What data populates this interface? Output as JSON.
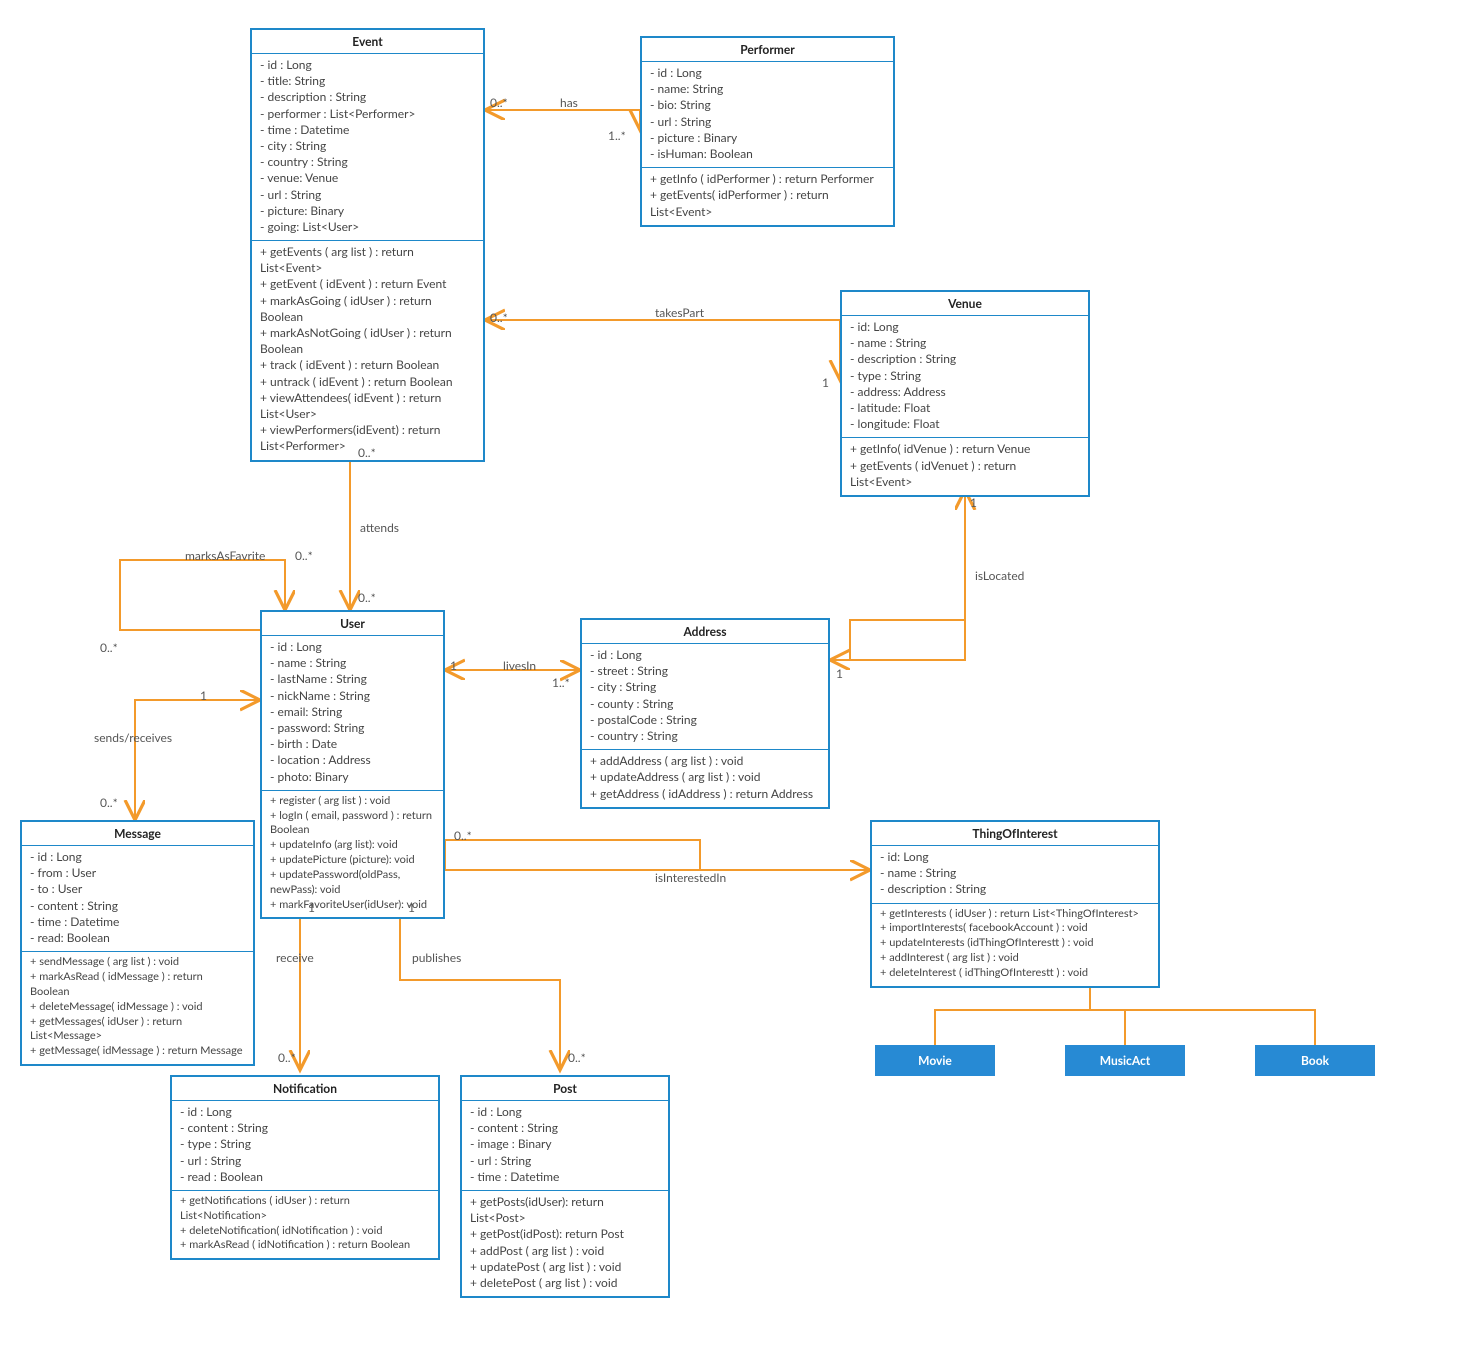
{
  "chart_data": {
    "type": "uml_class_diagram",
    "classes": [
      {
        "id": "Event",
        "title": "Event",
        "attributes": [
          "- id : Long",
          "- title: String",
          "- description : String",
          "- performer : List<Performer>",
          "- time : Datetime",
          "- city : String",
          "- country : String",
          "- venue: Venue",
          "- url : String",
          "- picture: Binary",
          "- going: List<User>"
        ],
        "methods": [
          "+ getEvents ( arg list ) : return List<Event>",
          "+ getEvent ( idEvent ) : return Event",
          "+ markAsGoing ( idUser ) : return Boolean",
          "+ markAsNotGoing ( idUser ) : return Boolean",
          "+ track ( idEvent ) : return Boolean",
          "+ untrack ( idEvent ) : return Boolean",
          "+ viewAttendees( idEvent ) : return List<User>",
          "+ viewPerformers(idEvent) : return List<Performer>"
        ]
      },
      {
        "id": "Performer",
        "title": "Performer",
        "attributes": [
          "- id : Long",
          "- name: String",
          "- bio: String",
          "- url : String",
          "- picture : Binary",
          "- isHuman: Boolean"
        ],
        "methods": [
          "+ getInfo ( idPerformer ) : return Performer",
          "+ getEvents( idPerformer ) : return List<Event>"
        ]
      },
      {
        "id": "Venue",
        "title": "Venue",
        "attributes": [
          "- id: Long",
          "- name : String",
          "- description : String",
          "- type : String",
          "- address: Address",
          "- latitude: Float",
          "- longitude: Float"
        ],
        "methods": [
          "+ getInfo( idVenue ) : return Venue",
          "+ getEvents ( idVenuet ) : return List<Event>"
        ]
      },
      {
        "id": "User",
        "title": "User",
        "attributes": [
          "- id : Long",
          "- name : String",
          "- lastName : String",
          "- nickName : String",
          "- email: String",
          "- password: String",
          "- birth : Date",
          "- location : Address",
          "- photo: Binary"
        ],
        "methods": [
          "+ register ( arg list ) : void",
          "+ logIn ( email, password ) : return Boolean",
          "+ updateInfo (arg list): void",
          "+ updatePicture (picture): void",
          "+ updatePassword(oldPass, newPass): void",
          "+ markFavoriteUser(idUser): void"
        ]
      },
      {
        "id": "Address",
        "title": "Address",
        "attributes": [
          "- id : Long",
          "- street : String",
          "- city : String",
          "- county : String",
          "- postalCode : String",
          "- country : String"
        ],
        "methods": [
          "+ addAddress ( arg list ) : void",
          "+ updateAddress ( arg list ) : void",
          "+ getAddress ( idAddress ) : return Address"
        ]
      },
      {
        "id": "Message",
        "title": "Message",
        "attributes": [
          "- id : Long",
          "- from : User",
          "- to : User",
          "- content : String",
          "- time : Datetime",
          "- read: Boolean"
        ],
        "methods": [
          "+ sendMessage ( arg list ) : void",
          "+ markAsRead ( idMessage ) : return Boolean",
          "+ deleteMessage( idMessage ) : void",
          "+ getMessages( idUser ) : return List<Message>",
          "+ getMessage( idMessage ) : return Message"
        ]
      },
      {
        "id": "ThingOfInterest",
        "title": "ThingOfInterest",
        "attributes": [
          "- id: Long",
          "- name : String",
          "- description : String"
        ],
        "methods": [
          "+ getInterests ( idUser ) : return List<ThingOfInterest>",
          "+ importInterests( facebookAccount ) : void",
          "+ updateInterests (idThingOfInterestt ) : void",
          "+ addInterest ( arg list ) : void",
          "+ deleteInterest ( idThingOfInterestt ) : void"
        ]
      },
      {
        "id": "Notification",
        "title": "Notification",
        "attributes": [
          "- id : Long",
          "- content : String",
          "- type : String",
          "- url : String",
          "- read : Boolean"
        ],
        "methods": [
          "+ getNotifications ( idUser ) : return List<Notification>",
          "+ deleteNotification( idNotification ) : void",
          "+ markAsRead ( idNotification ) : return Boolean"
        ]
      },
      {
        "id": "Post",
        "title": "Post",
        "attributes": [
          "- id : Long",
          "- content : String",
          "- image : Binary",
          "- url : String",
          "- time : Datetime"
        ],
        "methods": [
          "+ getPosts(idUser): return List<Post>",
          "+ getPost(idPost): return Post",
          "+ addPost ( arg list ) : void",
          "+ updatePost ( arg list ) : void",
          "+ deletePost ( arg list ) : void"
        ]
      },
      {
        "id": "Movie",
        "title": "Movie",
        "solid": true
      },
      {
        "id": "MusicAct",
        "title": "MusicAct",
        "solid": true
      },
      {
        "id": "Book",
        "title": "Book",
        "solid": true
      }
    ],
    "associations": [
      {
        "from": "Event",
        "to": "Performer",
        "label": "has",
        "from_mult": "0..*",
        "to_mult": "1..*"
      },
      {
        "from": "Event",
        "to": "Venue",
        "label": "takesPart",
        "from_mult": "0..*",
        "to_mult": "1"
      },
      {
        "from": "User",
        "to": "Event",
        "label": "attends",
        "from_mult": "0..*",
        "to_mult": "0..*"
      },
      {
        "from": "User",
        "to": "User",
        "label": "marksAsFavrite",
        "from_mult": "0..*",
        "to_mult": "0..*"
      },
      {
        "from": "User",
        "to": "Address",
        "label": "livesIn",
        "from_mult": "1",
        "to_mult": "1..*"
      },
      {
        "from": "User",
        "to": "Message",
        "label": "sends/receives",
        "from_mult": "1",
        "to_mult": "0..*"
      },
      {
        "from": "User",
        "to": "Notification",
        "label": "receive",
        "from_mult": "1",
        "to_mult": "0..*"
      },
      {
        "from": "User",
        "to": "Post",
        "label": "publishes",
        "from_mult": "1",
        "to_mult": "0..*"
      },
      {
        "from": "User",
        "to": "ThingOfInterest",
        "label": "isInterestedIn",
        "from_mult": "0..*",
        "to_mult": ""
      },
      {
        "from": "Venue",
        "to": "Address",
        "label": "isLocated",
        "from_mult": "1",
        "to_mult": "1"
      },
      {
        "from": "Movie",
        "to": "ThingOfInterest",
        "type": "generalization"
      },
      {
        "from": "MusicAct",
        "to": "ThingOfInterest",
        "type": "generalization"
      },
      {
        "from": "Book",
        "to": "ThingOfInterest",
        "type": "generalization"
      }
    ]
  },
  "labels": {
    "has": "has",
    "takesPart": "takesPart",
    "attends": "attends",
    "marksAsFavrite": "marksAsFavrite",
    "livesIn": "livesIn",
    "sends": "sends/receives",
    "receive": "receive",
    "publishes": "publishes",
    "isInterestedIn": "isInterestedIn",
    "isLocated": "isLocated",
    "m0s": "0..*",
    "m1": "1",
    "m1s": "1..*"
  }
}
